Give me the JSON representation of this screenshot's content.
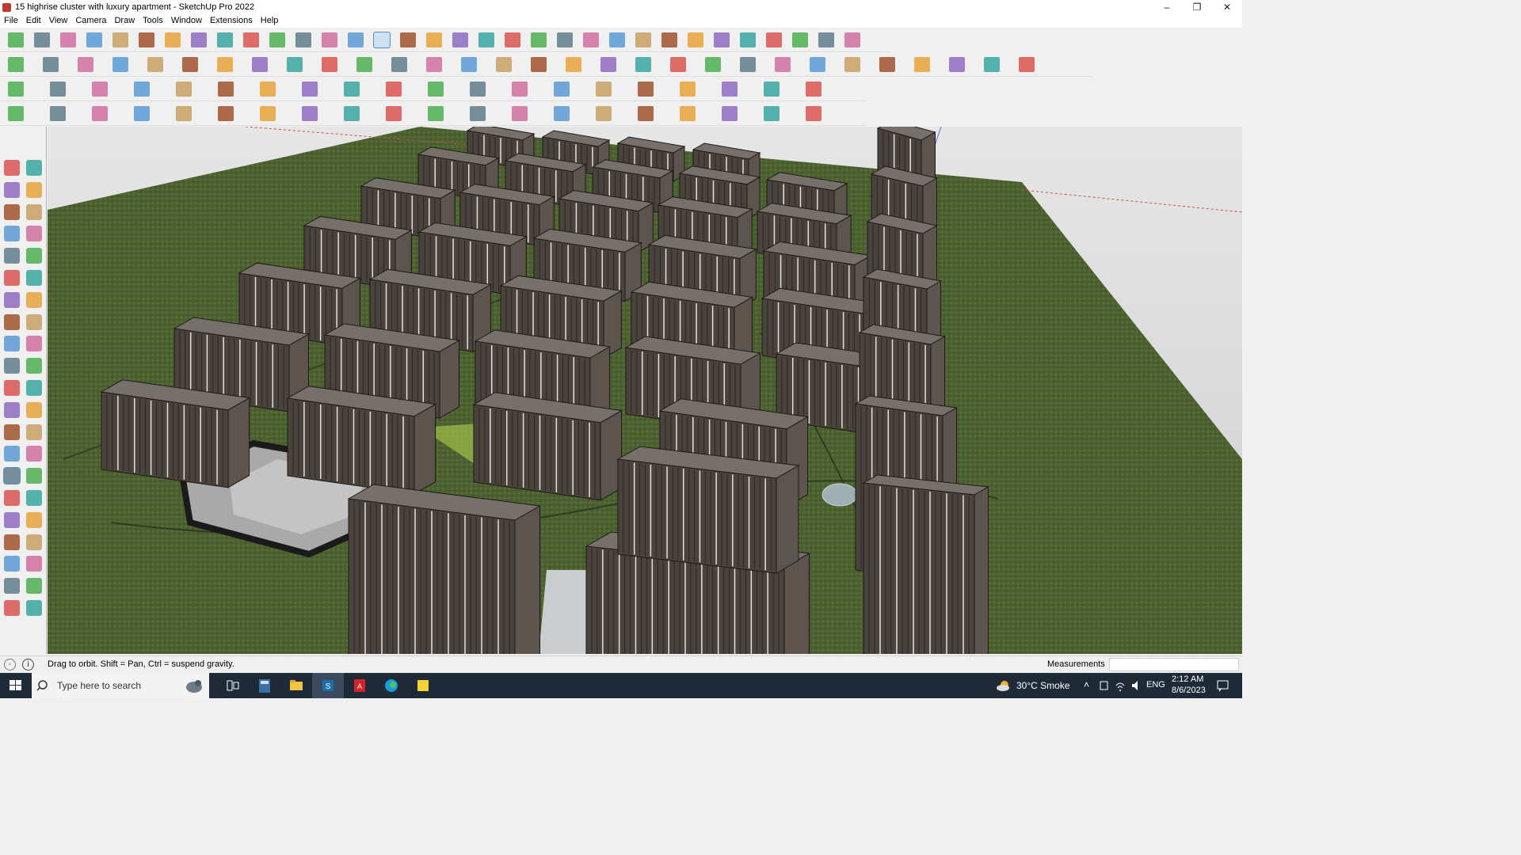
{
  "window": {
    "title": "15 highrise cluster with luxury apartment - SketchUp Pro 2022",
    "controls": {
      "minimize": "–",
      "maximize": "❐",
      "close": "✕"
    }
  },
  "menu": [
    "File",
    "Edit",
    "View",
    "Camera",
    "Draw",
    "Tools",
    "Window",
    "Extensions",
    "Help"
  ],
  "toolbars": {
    "row1_icons": [
      "search-icon",
      "select-icon",
      "eraser-icon",
      "line-icon",
      "arc-icon",
      "rectangle-icon",
      "push-pull-icon",
      "follow-me-icon",
      "move-icon",
      "rotate-icon",
      "scale-icon",
      "tape-measure-icon",
      "text-icon",
      "paint-bucket-icon",
      "orbit-icon",
      "pan-icon",
      "zoom-icon",
      "zoom-extents-icon",
      "layers-icon",
      "outliner-icon",
      "styles-icon",
      "scenes-icon",
      "account-icon",
      "warehouse-icon",
      "extension-warehouse-icon",
      "import-icon",
      "export-icon",
      "send-icon",
      "layout-icon",
      "sandbox-icon",
      "undo-icon",
      "redo-icon",
      "solar-icon"
    ],
    "row2_icons": [
      "iso-view-icon",
      "top-view-icon",
      "front-view-icon",
      "push-icon",
      "section-icon",
      "sandbox-from-contours-icon",
      "sandbox-scratch-icon",
      "smoove-icon",
      "stamp-icon",
      "drape-icon",
      "add-detail-icon",
      "flip-edge-icon",
      "solid-union-icon",
      "solid-subtract-icon",
      "solid-trim-icon",
      "solid-split-icon",
      "house-icon",
      "window-icon",
      "door-icon",
      "wall-icon",
      "roof-icon",
      "stair-icon",
      "text-style-icon",
      "tag-icon",
      "curve-icon",
      "circle-icon",
      "polygon-icon",
      "ellipse-icon",
      "paint-icon",
      "texture-icon"
    ],
    "row3_icons": [
      "cube-icon",
      "plane-icon",
      "extrude-icon",
      "shell-icon",
      "bend-icon",
      "round-corner-icon",
      "fillet-icon",
      "chamfer-icon",
      "offset-icon",
      "array-icon",
      "explode-icon",
      "weld-icon",
      "subdivide-icon",
      "spline-icon",
      "pipe-icon",
      "loft-icon",
      "rotate-copy-icon",
      "mirror-icon",
      "align-icon",
      "stack-icon"
    ],
    "row4_icons": [
      "bezier-icon",
      "polyline-icon",
      "freehand-icon",
      "edit-vertex-icon",
      "lathe-icon",
      "sweep-icon",
      "path-icon",
      "twist-icon",
      "taper-icon",
      "shear-icon",
      "bulge-icon",
      "stretch-icon",
      "wave-icon",
      "noise-icon",
      "grid-icon",
      "hatch-icon",
      "fence-icon",
      "railing-icon",
      "beam-icon",
      "column-icon"
    ]
  },
  "left_tray_icons": [
    "select-icon",
    "orbit-icon",
    "paint-bucket-icon",
    "eraser-icon",
    "component-icon",
    "tape-icon",
    "line-icon",
    "freehand-icon",
    "rectangle-icon",
    "rotated-rectangle-icon",
    "circle-icon",
    "polygon-icon",
    "arc-icon",
    "two-point-arc-icon",
    "pie-icon",
    "three-point-arc-icon",
    "move-icon",
    "push-pull-icon",
    "rotate-icon",
    "follow-me-icon",
    "scale-icon",
    "offset-icon",
    "tape-measure-icon",
    "dimension-icon",
    "protractor-icon",
    "text-icon",
    "axes-icon",
    "3d-text-icon",
    "orbit-active-icon",
    "pan-icon",
    "zoom-icon",
    "zoom-window-icon",
    "zoom-extents-icon",
    "previous-view-icon",
    "position-camera-icon",
    "look-around-icon",
    "walk-icon",
    "section-plane-icon",
    "section-display-icon",
    "section-cut-icon",
    "layers-icon",
    "outliner-icon"
  ],
  "status": {
    "hint": "Drag to orbit. Shift = Pan, Ctrl = suspend gravity.",
    "measurements_label": "Measurements",
    "measurements_value": ""
  },
  "taskbar": {
    "search_placeholder": "Type here to search",
    "weather": "30°C  Smoke",
    "language": "ENG",
    "time": "2:12 AM",
    "date": "8/6/2023",
    "apps": [
      "task-view-icon",
      "calculator-icon",
      "file-explorer-icon",
      "sketchup-icon",
      "acrobat-icon",
      "edge-icon",
      "sticky-notes-icon"
    ]
  },
  "colors": {
    "ground": "#4f6432",
    "building_facade": "#4d4640",
    "building_roof": "#6b6560",
    "plaza": "#b8b8b8"
  }
}
